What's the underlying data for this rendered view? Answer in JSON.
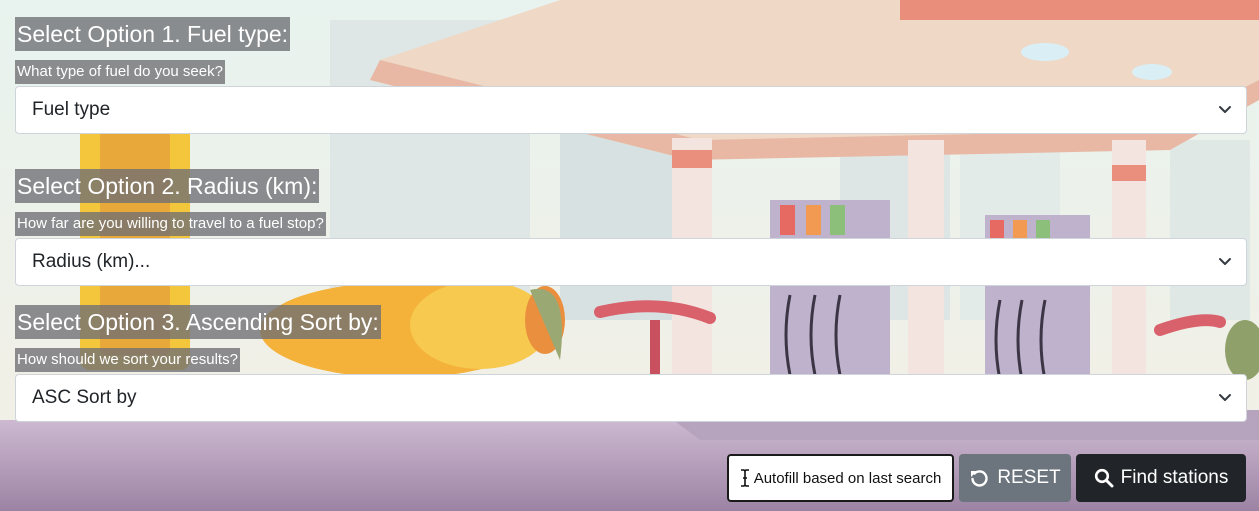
{
  "section1": {
    "heading": "Select Option 1. Fuel type:",
    "question": "What type of fuel do you seek?",
    "select_value": "Fuel type"
  },
  "section2": {
    "heading": "Select Option 2. Radius (km):",
    "question": "How far are you willing to travel to a fuel stop?",
    "select_value": "Radius (km)..."
  },
  "section3": {
    "heading": "Select Option 3. Ascending Sort by:",
    "question": "How should we sort your results?",
    "select_value": "ASC Sort by"
  },
  "actions": {
    "autofill_label": "Autofill based on last search",
    "autofill_icon": "text-cursor-icon",
    "reset_label": "RESET",
    "reset_icon": "undo-icon",
    "find_label": "Find stations",
    "find_icon": "search-icon"
  },
  "colors": {
    "label_bg": "#6e6e73",
    "reset_button": "#6c757d",
    "find_button": "#212529"
  }
}
